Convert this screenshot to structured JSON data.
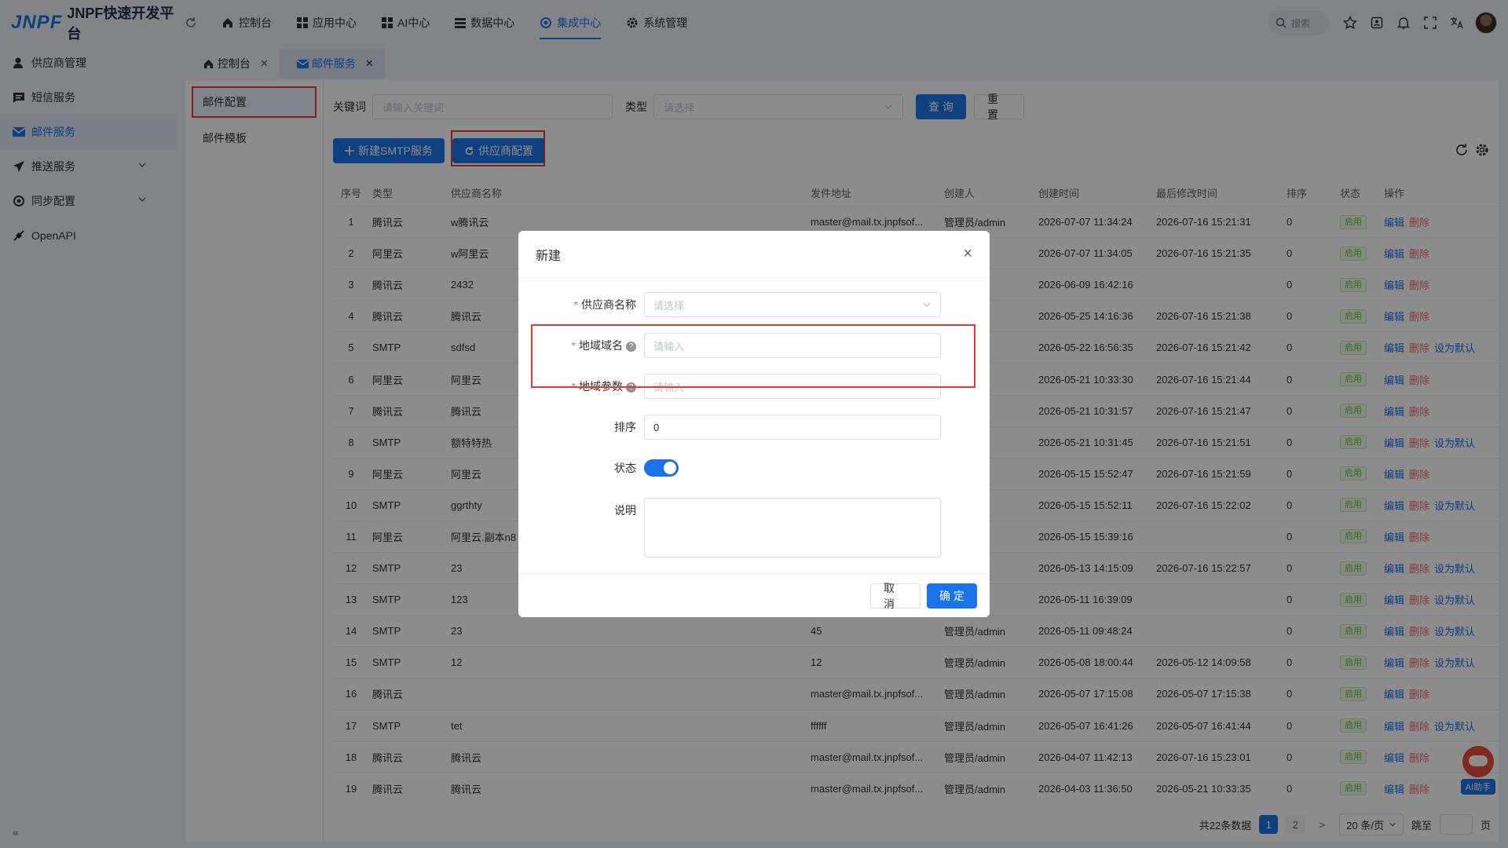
{
  "app": {
    "logo_mark": "JNPF",
    "title": "JNPF快速开发平台"
  },
  "nav": [
    {
      "label": "控制台",
      "icon": "home-icon"
    },
    {
      "label": "应用中心",
      "icon": "grid-icon"
    },
    {
      "label": "AI中心",
      "icon": "grid-icon"
    },
    {
      "label": "数据中心",
      "icon": "database-icon"
    },
    {
      "label": "集成中心",
      "icon": "integration-icon",
      "active": true
    },
    {
      "label": "系统管理",
      "icon": "gear-icon"
    }
  ],
  "top_right": {
    "search_placeholder": "搜索"
  },
  "sidebar": {
    "items": [
      {
        "label": "供应商管理",
        "icon": "user-icon"
      },
      {
        "label": "短信服务",
        "icon": "message-icon"
      },
      {
        "label": "邮件服务",
        "icon": "mail-icon",
        "active": true
      },
      {
        "label": "推送服务",
        "icon": "send-icon",
        "expandable": true
      },
      {
        "label": "同步配置",
        "icon": "sync-icon",
        "expandable": true
      },
      {
        "label": "OpenAPI",
        "icon": "api-icon"
      }
    ],
    "collapse": "«"
  },
  "tabs": [
    {
      "label": "控制台",
      "icon": "home-icon"
    },
    {
      "label": "邮件服务",
      "icon": "mail-icon",
      "active": true
    }
  ],
  "subnav": [
    {
      "label": "邮件配置",
      "active": true
    },
    {
      "label": "邮件模板"
    }
  ],
  "filter": {
    "keyword_label": "关键词",
    "keyword_placeholder": "请输入关键词",
    "type_label": "类型",
    "type_placeholder": "请选择",
    "query_button": "查 询",
    "reset_button": "重 置"
  },
  "toolbar": {
    "new_smtp": "新建SMTP服务",
    "vendor_config": "供应商配置"
  },
  "table": {
    "columns": [
      "序号",
      "类型",
      "供应商名称",
      "发件地址",
      "创建人",
      "创建时间",
      "最后修改时间",
      "排序",
      "状态",
      "操作"
    ],
    "status_label": "启用",
    "op_edit": "编辑",
    "op_delete": "删除",
    "op_default": "设为默认",
    "rows": [
      {
        "idx": "1",
        "type": "腾讯云",
        "name": "w腾讯云",
        "addr": "master@mail.tx.jnpfsof...",
        "creator": "管理员/admin",
        "ctime": "2026-07-07 11:34:24",
        "mtime": "2026-07-16 15:21:31",
        "sort": "0",
        "default": false
      },
      {
        "idx": "2",
        "type": "阿里云",
        "name": "w阿里云",
        "addr": "",
        "creator": "min",
        "ctime": "2026-07-07 11:34:05",
        "mtime": "2026-07-16 15:21:35",
        "sort": "0",
        "default": false
      },
      {
        "idx": "3",
        "type": "腾讯云",
        "name": "2432",
        "addr": "",
        "creator": "min",
        "ctime": "2026-06-09 16:42:16",
        "mtime": "",
        "sort": "0",
        "default": false
      },
      {
        "idx": "4",
        "type": "腾讯云",
        "name": "腾讯云",
        "addr": "",
        "creator": "min",
        "ctime": "2026-05-25 14:16:36",
        "mtime": "2026-07-16 15:21:38",
        "sort": "0",
        "default": false
      },
      {
        "idx": "5",
        "type": "SMTP",
        "name": "sdfsd",
        "addr": "",
        "creator": "min",
        "ctime": "2026-05-22 16:56:35",
        "mtime": "2026-07-16 15:21:42",
        "sort": "0",
        "default": true
      },
      {
        "idx": "6",
        "type": "阿里云",
        "name": "阿里云",
        "addr": "",
        "creator": "min",
        "ctime": "2026-05-21 10:33:30",
        "mtime": "2026-07-16 15:21:44",
        "sort": "0",
        "default": false
      },
      {
        "idx": "7",
        "type": "腾讯云",
        "name": "腾讯云",
        "addr": "",
        "creator": "min",
        "ctime": "2026-05-21 10:31:57",
        "mtime": "2026-07-16 15:21:47",
        "sort": "0",
        "default": false
      },
      {
        "idx": "8",
        "type": "SMTP",
        "name": "额特特热",
        "addr": "",
        "creator": "min",
        "ctime": "2026-05-21 10:31:45",
        "mtime": "2026-07-16 15:21:51",
        "sort": "0",
        "default": true
      },
      {
        "idx": "9",
        "type": "阿里云",
        "name": "阿里云",
        "addr": "",
        "creator": "min",
        "ctime": "2026-05-15 15:52:47",
        "mtime": "2026-07-16 15:21:59",
        "sort": "0",
        "default": false
      },
      {
        "idx": "10",
        "type": "SMTP",
        "name": "ggrthty",
        "addr": "",
        "creator": "min",
        "ctime": "2026-05-15 15:52:11",
        "mtime": "2026-07-16 15:22:02",
        "sort": "0",
        "default": true
      },
      {
        "idx": "11",
        "type": "阿里云",
        "name": "阿里云.副本n8",
        "addr": "",
        "creator": "min",
        "ctime": "2026-05-15 15:39:16",
        "mtime": "",
        "sort": "0",
        "default": false
      },
      {
        "idx": "12",
        "type": "SMTP",
        "name": "23",
        "addr": "",
        "creator": "min",
        "ctime": "2026-05-13 14:15:09",
        "mtime": "2026-07-16 15:22:57",
        "sort": "0",
        "default": true
      },
      {
        "idx": "13",
        "type": "SMTP",
        "name": "123",
        "addr": "",
        "creator": "min",
        "ctime": "2026-05-11 16:39:09",
        "mtime": "",
        "sort": "0",
        "default": true
      },
      {
        "idx": "14",
        "type": "SMTP",
        "name": "23",
        "addr": "45",
        "creator": "管理员/admin",
        "ctime": "2026-05-11 09:48:24",
        "mtime": "",
        "sort": "0",
        "default": true
      },
      {
        "idx": "15",
        "type": "SMTP",
        "name": "12",
        "addr": "12",
        "creator": "管理员/admin",
        "ctime": "2026-05-08 18:00:44",
        "mtime": "2026-05-12 14:09:58",
        "sort": "0",
        "default": true
      },
      {
        "idx": "16",
        "type": "腾讯云",
        "name": "",
        "addr": "master@mail.tx.jnpfsof...",
        "creator": "管理员/admin",
        "ctime": "2026-05-07 17:15:08",
        "mtime": "2026-05-07 17:15:38",
        "sort": "0",
        "default": false
      },
      {
        "idx": "17",
        "type": "SMTP",
        "name": "tet",
        "addr": "ffffff",
        "creator": "管理员/admin",
        "ctime": "2026-05-07 16:41:26",
        "mtime": "2026-05-07 16:41:44",
        "sort": "0",
        "default": true
      },
      {
        "idx": "18",
        "type": "腾讯云",
        "name": "腾讯云",
        "addr": "master@mail.tx.jnpfsof...",
        "creator": "管理员/admin",
        "ctime": "2026-04-07 11:42:13",
        "mtime": "2026-07-16 15:23:01",
        "sort": "0",
        "default": false
      },
      {
        "idx": "19",
        "type": "腾讯云",
        "name": "腾讯云",
        "addr": "master@mail.tx.jnpfsof...",
        "creator": "管理员/admin",
        "ctime": "2026-04-03 11:36:50",
        "mtime": "2026-05-21 10:33:35",
        "sort": "0",
        "default": false
      }
    ]
  },
  "pager": {
    "total": "共22条数据",
    "pages": [
      "1",
      "2"
    ],
    "next": ">",
    "size": "20 条/页",
    "jump_label": "跳至",
    "jump_suffix": "页"
  },
  "modal": {
    "title": "新建",
    "close": "×",
    "fields": {
      "vendor_label": "供应商名称",
      "vendor_placeholder": "请选择",
      "domain_label": "地域域名",
      "domain_placeholder": "请输入",
      "param_label": "地域参数",
      "param_placeholder": "请输入",
      "sort_label": "排序",
      "sort_value": "0",
      "status_label": "状态",
      "status_on": true,
      "desc_label": "说明"
    },
    "cancel": "取 消",
    "confirm": "确 定"
  },
  "ai_helper": {
    "label": "AI助手"
  },
  "colors": {
    "primary": "#1a73e8",
    "danger": "#f56c6c",
    "success": "#67c23a",
    "highlight": "#e53935"
  }
}
